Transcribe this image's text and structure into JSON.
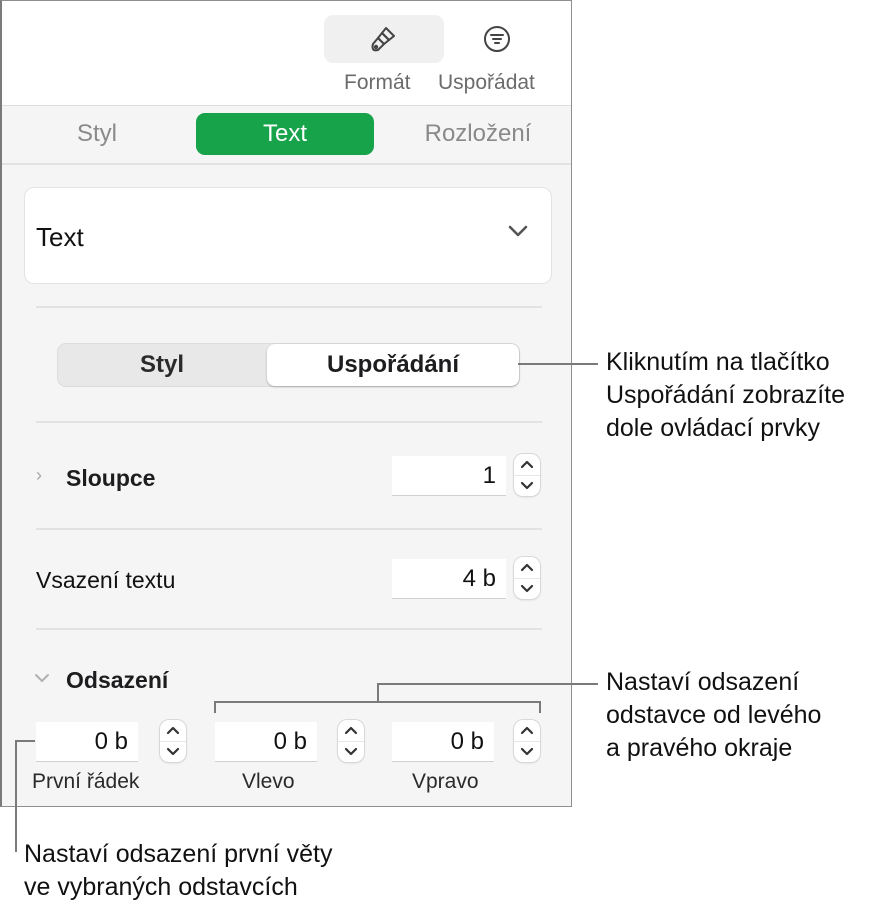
{
  "toolbar": {
    "buttons": [
      {
        "label": "Formát",
        "icon": "paintbrush-icon",
        "active": true
      },
      {
        "label": "Uspořádat",
        "icon": "arrange-icon",
        "active": false
      }
    ]
  },
  "tabs": [
    {
      "label": "Styl",
      "active": false
    },
    {
      "label": "Text",
      "active": true
    },
    {
      "label": "Rozložení",
      "active": false
    }
  ],
  "paragraph_style": {
    "value": "Text"
  },
  "segmented": [
    {
      "label": "Styl",
      "active": false
    },
    {
      "label": "Uspořádání",
      "active": true
    }
  ],
  "columns": {
    "label": "Sloupce",
    "value": "1"
  },
  "text_inset": {
    "label": "Vsazení textu",
    "value": "4 b"
  },
  "indents": {
    "label": "Odsazení",
    "fields": [
      {
        "label": "První řádek",
        "value": "0 b"
      },
      {
        "label": "Vlevo",
        "value": "0 b"
      },
      {
        "label": "Vpravo",
        "value": "0 b"
      }
    ]
  },
  "callouts": {
    "layout_button": [
      "Kliknutím na tlačítko",
      "Uspořádání zobrazíte",
      "dole ovládací prvky"
    ],
    "left_right": [
      "Nastaví odsazení",
      "odstavce od levého",
      "a pravého okraje"
    ],
    "first_line": [
      "Nastaví odsazení první věty",
      "ve vybraných odstavcích"
    ]
  },
  "colors": {
    "accent": "#17a34a"
  }
}
